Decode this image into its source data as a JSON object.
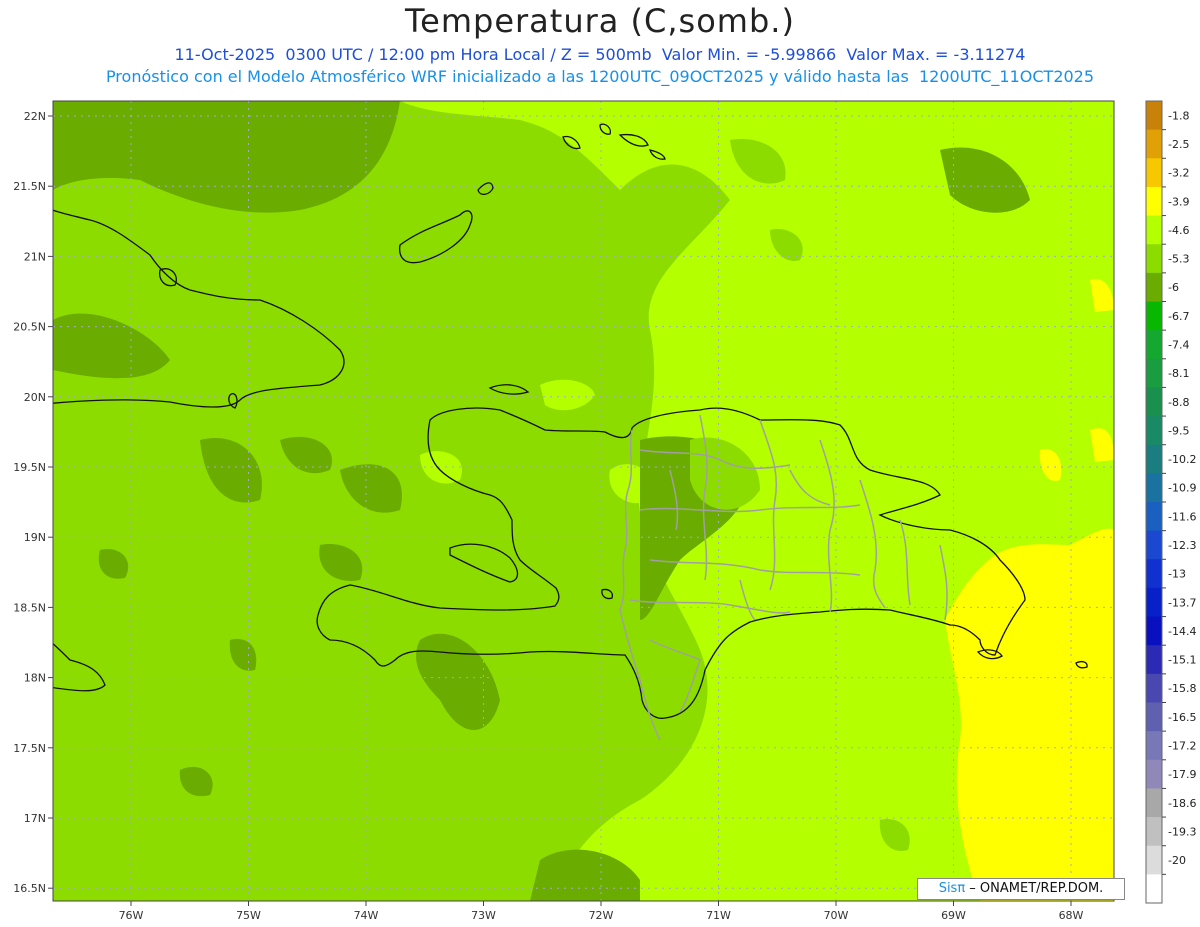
{
  "title": "Temperatura (C,somb.)",
  "subtitle_line1": "11-Oct-2025  0300 UTC / 12:00 pm Hora Local / Z = 500mb  Valor Min. = -5.99866  Valor Max. = -3.11274",
  "subtitle_line2": "Pronóstico con el Modelo Atmosférico WRF inicializado a las 1200UTC_09OCT2025 y válido hasta las  1200UTC_11OCT2025",
  "credit": {
    "brand": "Sisπ",
    "rest": " – ONAMET/REP.DOM."
  },
  "chart_data": {
    "type": "heatmap",
    "title": "Temperatura (C,somb.)",
    "xlabel": "",
    "ylabel": "",
    "x_ticks": [
      "76W",
      "75W",
      "74W",
      "73W",
      "72W",
      "71W",
      "70W",
      "69W",
      "68W"
    ],
    "y_ticks": [
      "22N",
      "21.5N",
      "21N",
      "20.5N",
      "20N",
      "19.5N",
      "19N",
      "18.5N",
      "18N",
      "17.5N",
      "17N",
      "16.5N"
    ],
    "grid": true,
    "value_min": -5.99866,
    "value_max": -3.11274,
    "colorbar": {
      "labels": [
        "-1.8",
        "-2.5",
        "-3.2",
        "-3.9",
        "-4.6",
        "-5.3",
        "-6",
        "-6.7",
        "-7.4",
        "-8.1",
        "-8.8",
        "-9.5",
        "-10.2",
        "-10.9",
        "-11.6",
        "-12.3",
        "-13",
        "-13.7",
        "-14.4",
        "-15.1",
        "-15.8",
        "-16.5",
        "-17.2",
        "-17.9",
        "-18.6",
        "-19.3",
        "-20"
      ],
      "colors": [
        "#c8820a",
        "#e2a007",
        "#f7c800",
        "#ffff00",
        "#b4ff00",
        "#8ddc00",
        "#6aac00",
        "#08b800",
        "#14a830",
        "#1a9c40",
        "#1a904e",
        "#1a8a66",
        "#1a7e80",
        "#1a72a0",
        "#1a60c0",
        "#1a48d0",
        "#1030d0",
        "#0820c8",
        "#0810c0",
        "#2a2ab4",
        "#4848b0",
        "#6060b0",
        "#7878b8",
        "#9088b8",
        "#a8a8a8",
        "#c0c0c0",
        "#dcdcdc",
        "#ffffff"
      ]
    },
    "field_colors": {
      "t_minus_6_to_5_3": "#6aac00",
      "t_minus_5_3_to_4_6": "#8ddc00",
      "t_minus_4_6_to_3_9": "#b4ff00",
      "t_minus_3_9_to_3_2": "#ffff00"
    }
  }
}
